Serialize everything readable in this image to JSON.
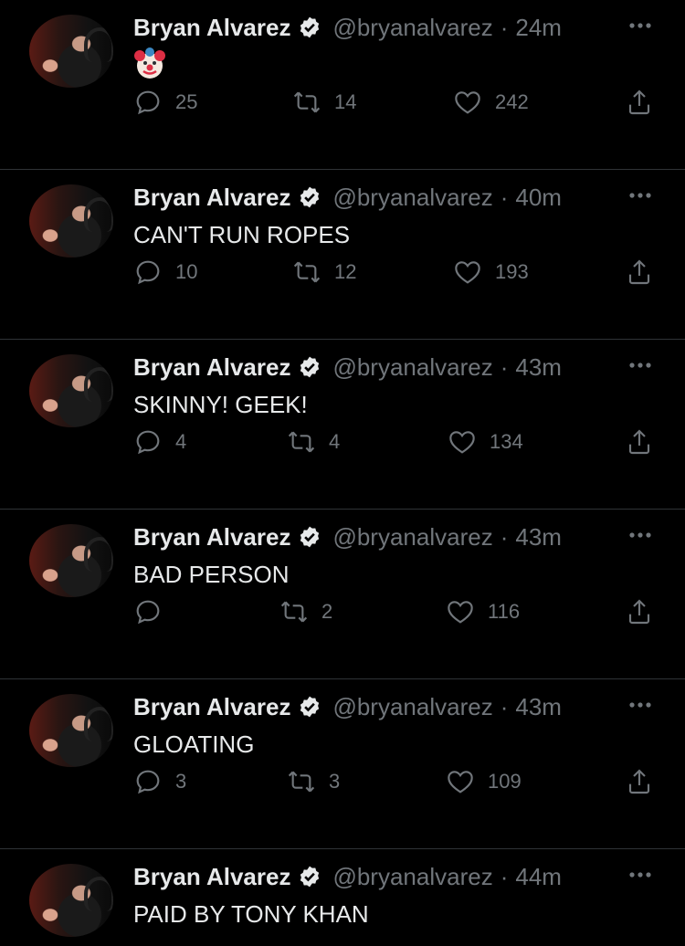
{
  "tweets": [
    {
      "name": "Bryan Alvarez",
      "handle": "@bryanalvarez",
      "time": "24m",
      "text": "",
      "emoji": "clown-face",
      "replies": "25",
      "retweets": "14",
      "likes": "242"
    },
    {
      "name": "Bryan Alvarez",
      "handle": "@bryanalvarez",
      "time": "40m",
      "text": "CAN'T RUN ROPES",
      "replies": "10",
      "retweets": "12",
      "likes": "193"
    },
    {
      "name": "Bryan Alvarez",
      "handle": "@bryanalvarez",
      "time": "43m",
      "text": "SKINNY! GEEK!",
      "replies": "4",
      "retweets": "4",
      "likes": "134"
    },
    {
      "name": "Bryan Alvarez",
      "handle": "@bryanalvarez",
      "time": "43m",
      "text": "BAD PERSON",
      "replies": "",
      "retweets": "2",
      "likes": "116"
    },
    {
      "name": "Bryan Alvarez",
      "handle": "@bryanalvarez",
      "time": "43m",
      "text": "GLOATING",
      "replies": "3",
      "retweets": "3",
      "likes": "109"
    },
    {
      "name": "Bryan Alvarez",
      "handle": "@bryanalvarez",
      "time": "44m",
      "text": "PAID BY TONY KHAN",
      "replies": "",
      "retweets": "",
      "likes": ""
    }
  ],
  "separator": "·",
  "colors": {
    "background": "#000000",
    "text": "#e7e9ea",
    "muted": "#71767b",
    "divider": "#2f3336"
  }
}
